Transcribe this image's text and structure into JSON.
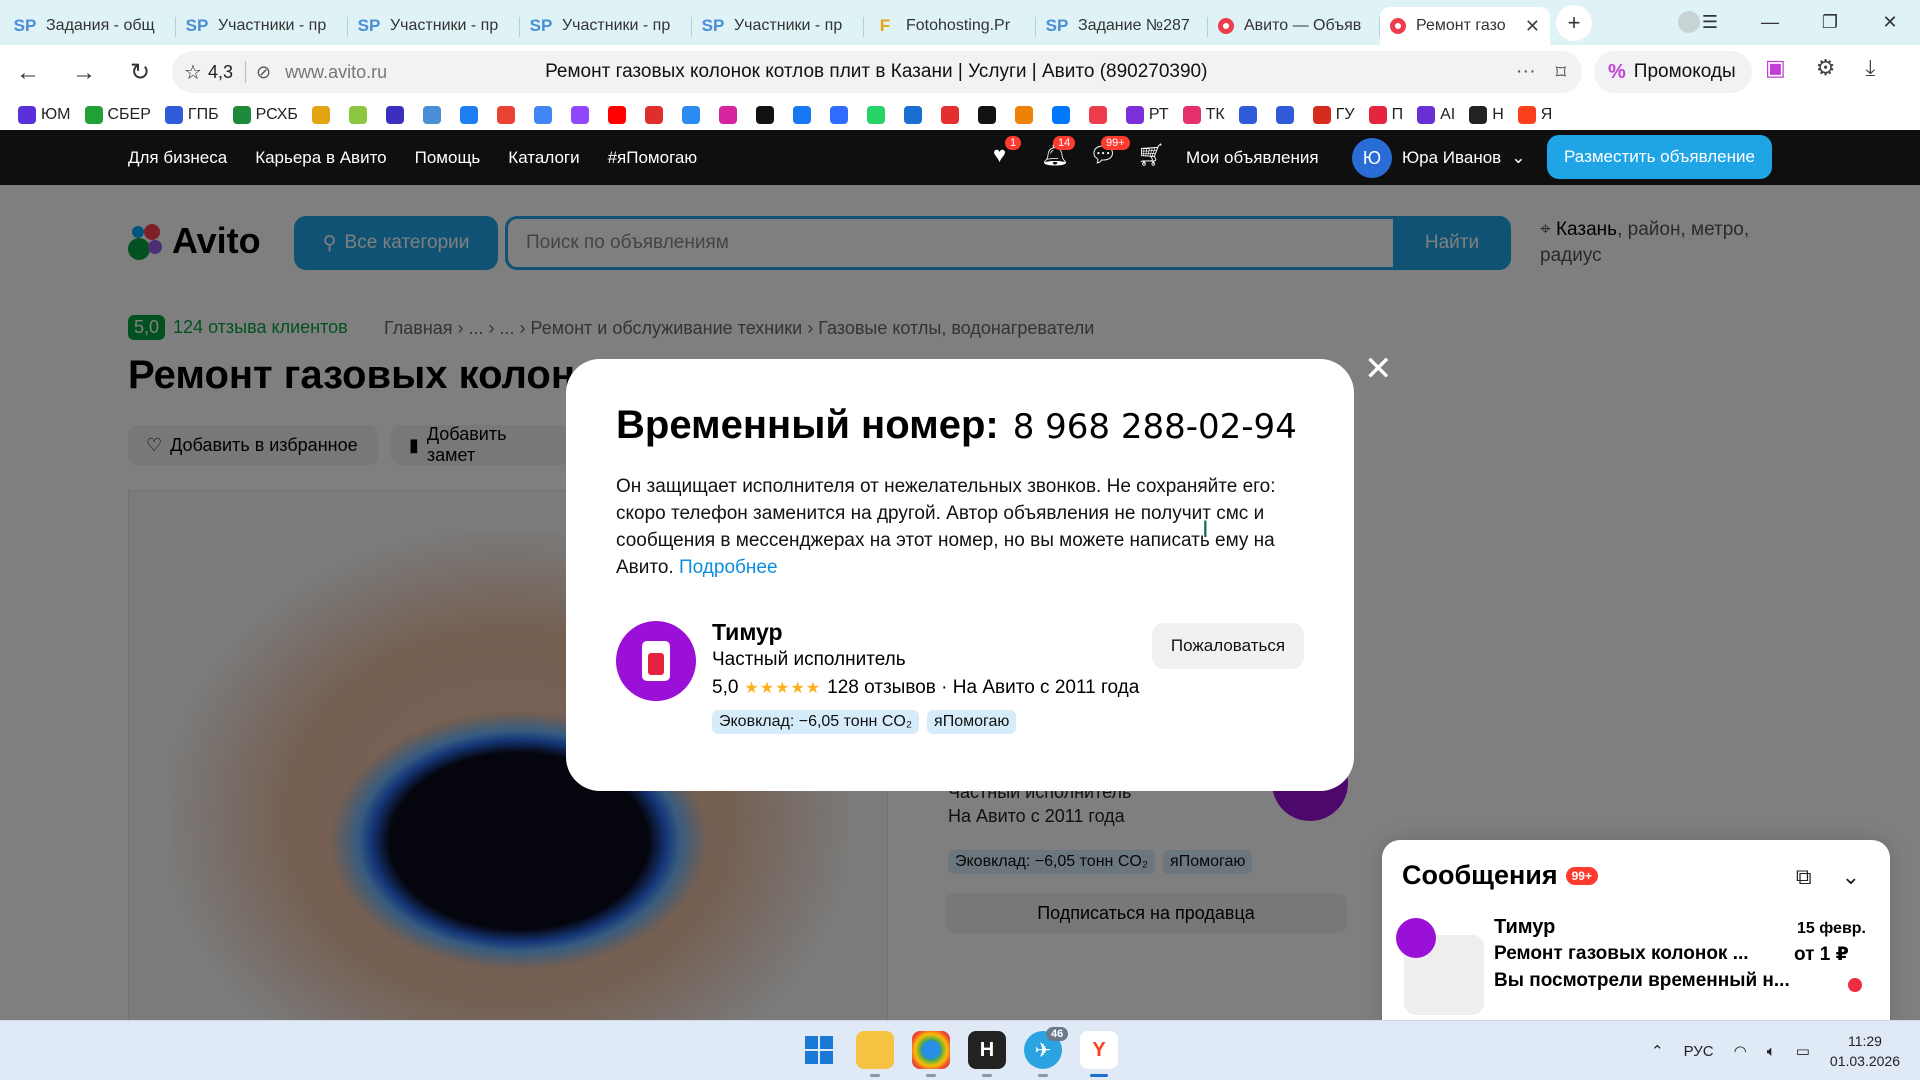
{
  "browser": {
    "tabs": [
      {
        "icon": "sp-icon",
        "favicon_text": "SP",
        "title": "Задания - общ"
      },
      {
        "icon": "sp-icon",
        "favicon_text": "SP",
        "title": "Участники - пр"
      },
      {
        "icon": "sp-icon",
        "favicon_text": "SP",
        "title": "Участники - пр"
      },
      {
        "icon": "sp-icon",
        "favicon_text": "SP",
        "title": "Участники - пр"
      },
      {
        "icon": "sp-icon",
        "favicon_text": "SP",
        "title": "Участники - пр"
      },
      {
        "icon": "fotohosting-icon",
        "favicon_text": "F",
        "title": "Fotohosting.Pr"
      },
      {
        "icon": "sp-icon",
        "favicon_text": "SP",
        "title": "Задание №287"
      },
      {
        "icon": "avito-icon",
        "favicon_text": "",
        "title": "Авито — Объяв"
      },
      {
        "icon": "avito-icon",
        "favicon_text": "",
        "title": "Ремонт газо",
        "active": true
      }
    ],
    "new_tab": "+",
    "address": {
      "rating": "4,3",
      "host": "www.avito.ru",
      "title": "Ремонт газовых колонок котлов плит в Казани | Услуги | Авито (890270390)"
    },
    "promo_label": "Промокоды",
    "promo_symbol": "%",
    "bookmarks": [
      {
        "label": "ЮМ",
        "color": "#5b2fd9"
      },
      {
        "label": "СБЕР",
        "color": "#21a038"
      },
      {
        "label": "ГПБ",
        "color": "#2f5bd9"
      },
      {
        "label": "РСХБ",
        "color": "#1d8a3b"
      },
      {
        "label": "",
        "color": "#e3a514"
      },
      {
        "label": "",
        "color": "#8dc63f"
      },
      {
        "label": "",
        "color": "#3b2fbf"
      },
      {
        "label": "",
        "color": "#4a8fd6"
      },
      {
        "label": "",
        "color": "#1c7ef2"
      },
      {
        "label": "",
        "color": "#ea4335"
      },
      {
        "label": "",
        "color": "#4285f4"
      },
      {
        "label": "",
        "color": "#9146ff"
      },
      {
        "label": "",
        "color": "#ff0000"
      },
      {
        "label": "",
        "color": "#e02e2e"
      },
      {
        "label": "",
        "color": "#2b8bf2"
      },
      {
        "label": "",
        "color": "#d6249f"
      },
      {
        "label": "",
        "color": "#111111"
      },
      {
        "label": "",
        "color": "#1877f2"
      },
      {
        "label": "",
        "color": "#2f6bff"
      },
      {
        "label": "",
        "color": "#25d366"
      },
      {
        "label": "",
        "color": "#1a6fd1"
      },
      {
        "label": "",
        "color": "#e52e2e"
      },
      {
        "label": "",
        "color": "#111111"
      },
      {
        "label": "",
        "color": "#ee8208"
      },
      {
        "label": "",
        "color": "#0077ff"
      },
      {
        "label": "",
        "color": "#ee3c4c"
      },
      {
        "label": "РТ",
        "color": "#7b2fd6"
      },
      {
        "label": "ТК",
        "color": "#e52e6e"
      },
      {
        "label": "",
        "color": "#2f5bd9"
      },
      {
        "label": "",
        "color": "#2f5bd9"
      },
      {
        "label": "ГУ",
        "color": "#d52b1e"
      },
      {
        "label": "П",
        "color": "#e5243f"
      },
      {
        "label": "AI",
        "color": "#6b2fd6"
      },
      {
        "label": "Н",
        "color": "#222222"
      },
      {
        "label": "Я",
        "color": "#fc3f1d"
      }
    ]
  },
  "header": {
    "nav": [
      "Для бизнеса",
      "Карьера в Авито",
      "Помощь",
      "Каталоги",
      "#яПомогаю"
    ],
    "badges": {
      "favorites": "1",
      "notifications": "14",
      "messages": "99+"
    },
    "my_ads": "Мои объявления",
    "user_initial": "Ю",
    "user_name": "Юра Иванов",
    "post_button": "Разместить объявление"
  },
  "search": {
    "logo": "Avito",
    "categories": "Все категории",
    "placeholder": "Поиск по объявлениям",
    "find": "Найти",
    "location_city": "Казань",
    "location_rest": ", район, метро, радиус"
  },
  "listing": {
    "score": "5,0",
    "reviews": "124 отзыва клиентов",
    "breadcrumbs": "Главная › ... › ... › Ремонт и обслуживание техники › Газовые котлы, водонагреватели",
    "title": "Ремонт газовых колон",
    "add_fav": "Добавить в избранное",
    "add_note": "Добавить замет",
    "seller_type": "Частный исполнитель",
    "seller_since": "На Авито с 2011 года",
    "subscribe": "Подписаться на продавца"
  },
  "modal": {
    "title": "Временный номер:",
    "phone": "8 968 288-02-94",
    "text": "Он защищает исполнителя от нежелательных звонков. Не сохраняйте его: скоро телефон заменится на другой. Автор объявления не получит смс и сообщения в мессенджерах на этот номер, но вы можете написать ему на Авито.",
    "more_link": "Подробнее",
    "seller_name": "Тимур",
    "seller_type": "Частный исполнитель",
    "rating": "5,0",
    "stars": "★★★★★",
    "reviews_since": "128 отзывов · На Авито с 2011 года",
    "tags": [
      "Эковклад: −6,05 тонн CO₂",
      "яПомогаю"
    ],
    "complain": "Пожаловаться"
  },
  "messages": {
    "title": "Сообщения",
    "badge": "99+",
    "name": "Тимур",
    "date": "15 февр.",
    "line1": "Ремонт газовых колонок ...",
    "price": "от 1 ₽",
    "line2": "Вы посмотрели временный н..."
  },
  "taskbar": {
    "language": "РУС",
    "time": "11:29",
    "date": "01.03.2026",
    "telegram_badge": "46"
  }
}
